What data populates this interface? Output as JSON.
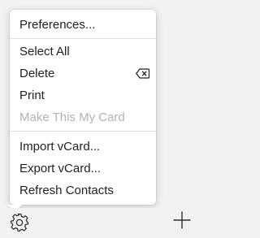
{
  "menu": {
    "preferences": "Preferences...",
    "select_all": "Select All",
    "delete": "Delete",
    "print": "Print",
    "make_my_card": "Make This My Card",
    "import_vcard": "Import vCard...",
    "export_vcard": "Export vCard...",
    "refresh_contacts": "Refresh Contacts",
    "delete_shortcut_icon": "delete-key-icon"
  },
  "toolbar": {
    "settings_icon": "gear-icon",
    "add_icon": "plus-icon"
  }
}
